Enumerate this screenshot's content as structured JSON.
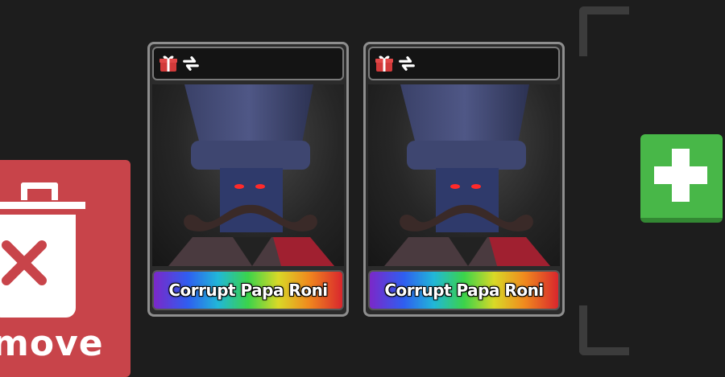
{
  "remove_button": {
    "label": "move"
  },
  "items": [
    {
      "name": "Corrupt Papa Roni",
      "icons": [
        "gift-icon",
        "trade-icon"
      ]
    },
    {
      "name": "Corrupt Papa Roni",
      "icons": [
        "gift-icon",
        "trade-icon"
      ]
    }
  ],
  "add_button": {
    "icon": "plus-icon"
  },
  "colors": {
    "background": "#1d1d1d",
    "remove": "#c8444a",
    "add": "#48b748",
    "card_border": "#8e8e8e"
  }
}
